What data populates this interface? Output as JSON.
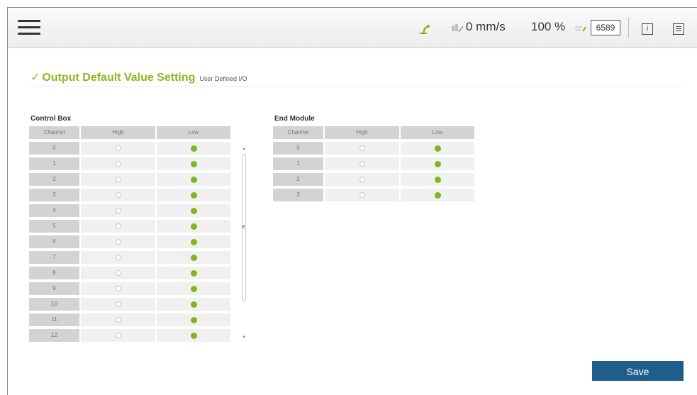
{
  "topbar": {
    "speed_text": "0 mm/s",
    "percent_text": "100 %",
    "id_box": "6589",
    "info_icon_glyph": "i"
  },
  "page": {
    "check_glyph": "✓",
    "title": "Output Default Value Setting",
    "subtitle": "User Defined I/O"
  },
  "control_box": {
    "label": "Control Box",
    "headers": [
      "Channel",
      "High",
      "Low"
    ],
    "rows": [
      {
        "channel": "0",
        "value": "Low"
      },
      {
        "channel": "1",
        "value": "Low"
      },
      {
        "channel": "2",
        "value": "Low"
      },
      {
        "channel": "3",
        "value": "Low"
      },
      {
        "channel": "4",
        "value": "Low"
      },
      {
        "channel": "5",
        "value": "Low"
      },
      {
        "channel": "6",
        "value": "Low"
      },
      {
        "channel": "7",
        "value": "Low"
      },
      {
        "channel": "8",
        "value": "Low"
      },
      {
        "channel": "9",
        "value": "Low"
      },
      {
        "channel": "10",
        "value": "Low"
      },
      {
        "channel": "11",
        "value": "Low"
      },
      {
        "channel": "12",
        "value": "Low"
      }
    ]
  },
  "end_module": {
    "label": "End Module",
    "headers": [
      "Channel",
      "High",
      "Low"
    ],
    "rows": [
      {
        "channel": "0",
        "value": "Low"
      },
      {
        "channel": "1",
        "value": "Low"
      },
      {
        "channel": "2",
        "value": "Low"
      },
      {
        "channel": "3",
        "value": "Low"
      }
    ]
  },
  "save_label": "Save",
  "colors": {
    "accent_green": "#8cb822",
    "radio_green": "#7fb81d",
    "save_blue": "#1f5e8c"
  }
}
